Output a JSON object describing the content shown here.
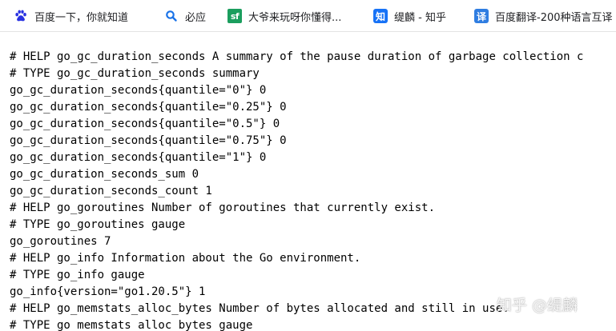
{
  "bookmarks": [
    {
      "label": "百度一下，你就知道",
      "icon": "baidu-paw-icon"
    },
    {
      "label": "必应",
      "icon": "search-icon"
    },
    {
      "label": "大爷来玩呀你懂得...",
      "icon": "sf-icon",
      "icon_text": "sf"
    },
    {
      "label": "缇麟 - 知乎",
      "icon": "zhihu-icon",
      "icon_text": "知"
    },
    {
      "label": "百度翻译-200种语言互译",
      "icon": "translate-icon",
      "icon_text": "译"
    }
  ],
  "colors": {
    "baidu_blue": "#2932e1",
    "search_blue": "#1a73e8",
    "sf_green": "#1b9e5e",
    "zhihu_blue": "#1772f6",
    "translate_blue": "#2f7de1"
  },
  "metrics_lines": [
    "# HELP go_gc_duration_seconds A summary of the pause duration of garbage collection c",
    "# TYPE go_gc_duration_seconds summary",
    "go_gc_duration_seconds{quantile=\"0\"} 0",
    "go_gc_duration_seconds{quantile=\"0.25\"} 0",
    "go_gc_duration_seconds{quantile=\"0.5\"} 0",
    "go_gc_duration_seconds{quantile=\"0.75\"} 0",
    "go_gc_duration_seconds{quantile=\"1\"} 0",
    "go_gc_duration_seconds_sum 0",
    "go_gc_duration_seconds_count 1",
    "# HELP go_goroutines Number of goroutines that currently exist.",
    "# TYPE go_goroutines gauge",
    "go_goroutines 7",
    "# HELP go_info Information about the Go environment.",
    "# TYPE go_info gauge",
    "go_info{version=\"go1.20.5\"} 1",
    "# HELP go_memstats_alloc_bytes Number of bytes allocated and still in use.",
    "# TYPE go_memstats_alloc_bytes gauge"
  ],
  "watermark": "知乎 @缇麟"
}
